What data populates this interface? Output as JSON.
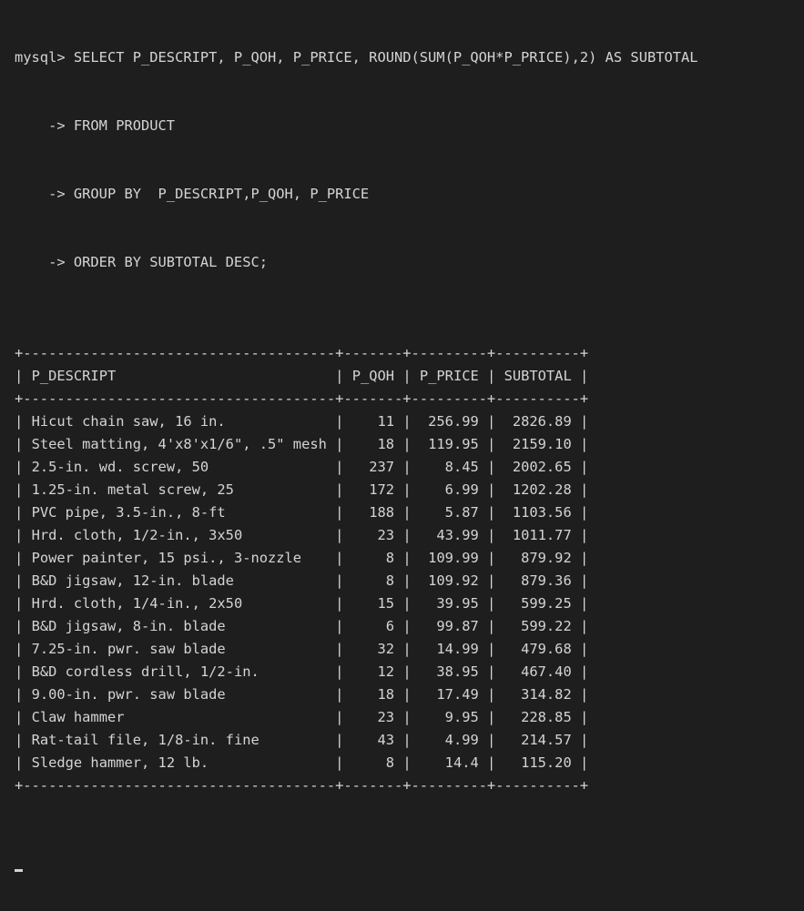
{
  "prompt": "mysql> ",
  "continuation_prompt": "    -> ",
  "query_lines": [
    "SELECT P_DESCRIPT, P_QOH, P_PRICE, ROUND(SUM(P_QOH*P_PRICE),2) AS SUBTOTAL",
    "FROM PRODUCT",
    "GROUP BY  P_DESCRIPT,P_QOH, P_PRICE",
    "ORDER BY SUBTOTAL DESC;"
  ],
  "table": {
    "columns": [
      "P_DESCRIPT",
      "P_QOH",
      "P_PRICE",
      "SUBTOTAL"
    ],
    "rows": [
      [
        "Hicut chain saw, 16 in.",
        "11",
        "256.99",
        "2826.89"
      ],
      [
        "Steel matting, 4'x8'x1/6\", .5\" mesh",
        "18",
        "119.95",
        "2159.10"
      ],
      [
        "2.5-in. wd. screw, 50",
        "237",
        "8.45",
        "2002.65"
      ],
      [
        "1.25-in. metal screw, 25",
        "172",
        "6.99",
        "1202.28"
      ],
      [
        "PVC pipe, 3.5-in., 8-ft",
        "188",
        "5.87",
        "1103.56"
      ],
      [
        "Hrd. cloth, 1/2-in., 3x50",
        "23",
        "43.99",
        "1011.77"
      ],
      [
        "Power painter, 15 psi., 3-nozzle",
        "8",
        "109.99",
        "879.92"
      ],
      [
        "B&D jigsaw, 12-in. blade",
        "8",
        "109.92",
        "879.36"
      ],
      [
        "Hrd. cloth, 1/4-in., 2x50",
        "15",
        "39.95",
        "599.25"
      ],
      [
        "B&D jigsaw, 8-in. blade",
        "6",
        "99.87",
        "599.22"
      ],
      [
        "7.25-in. pwr. saw blade",
        "32",
        "14.99",
        "479.68"
      ],
      [
        "B&D cordless drill, 1/2-in.",
        "12",
        "38.95",
        "467.40"
      ],
      [
        "9.00-in. pwr. saw blade",
        "18",
        "17.49",
        "314.82"
      ],
      [
        "Claw hammer",
        "23",
        "9.95",
        "228.85"
      ],
      [
        "Rat-tail file, 1/8-in. fine",
        "43",
        "4.99",
        "214.57"
      ],
      [
        "Sledge hammer, 12 lb.",
        "8",
        "14.4",
        "115.20"
      ]
    ]
  }
}
